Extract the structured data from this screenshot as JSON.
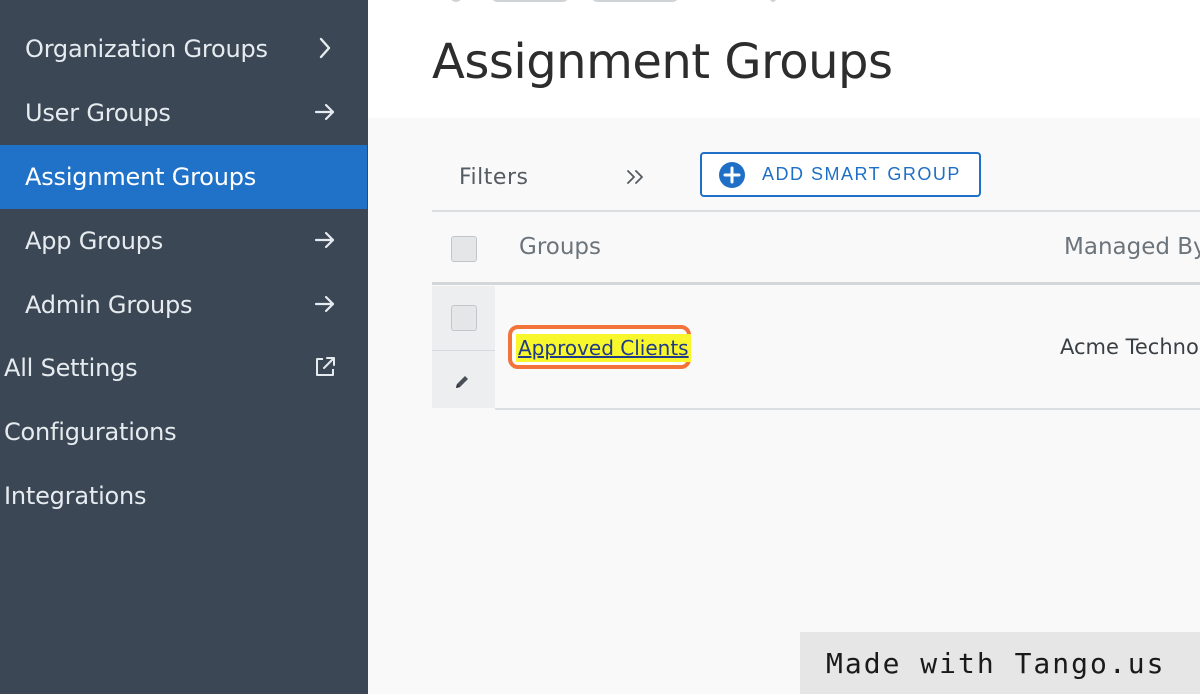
{
  "sidebar": {
    "items": [
      {
        "label": "Organization Groups",
        "trail_icon": "chevron-right-icon"
      },
      {
        "label": "User Groups",
        "trail_icon": "arrow-right-icon"
      },
      {
        "label": "Assignment Groups",
        "trail_icon": "",
        "active": true
      },
      {
        "label": "App Groups",
        "trail_icon": "arrow-right-icon"
      },
      {
        "label": "Admin Groups",
        "trail_icon": "arrow-right-icon"
      },
      {
        "label": "All Settings",
        "trail_icon": "external-link-icon"
      },
      {
        "label": "Configurations",
        "trail_icon": ""
      },
      {
        "label": "Integrations",
        "trail_icon": ""
      }
    ]
  },
  "page": {
    "title": "Assignment Groups"
  },
  "toolbar": {
    "filters_label": "Filters",
    "add_button_label": "ADD SMART GROUP"
  },
  "table": {
    "columns": [
      "Groups",
      "Managed By"
    ],
    "rows": [
      {
        "group": "Approved Clients",
        "managed_by": "Acme Technolo"
      }
    ]
  },
  "watermark": "Made with Tango.us",
  "colors": {
    "sidebar_bg": "#3b4754",
    "active_bg": "#1f72c8",
    "accent": "#1f6fc6",
    "highlight": "#f7f72c",
    "callout": "#f2743b"
  }
}
